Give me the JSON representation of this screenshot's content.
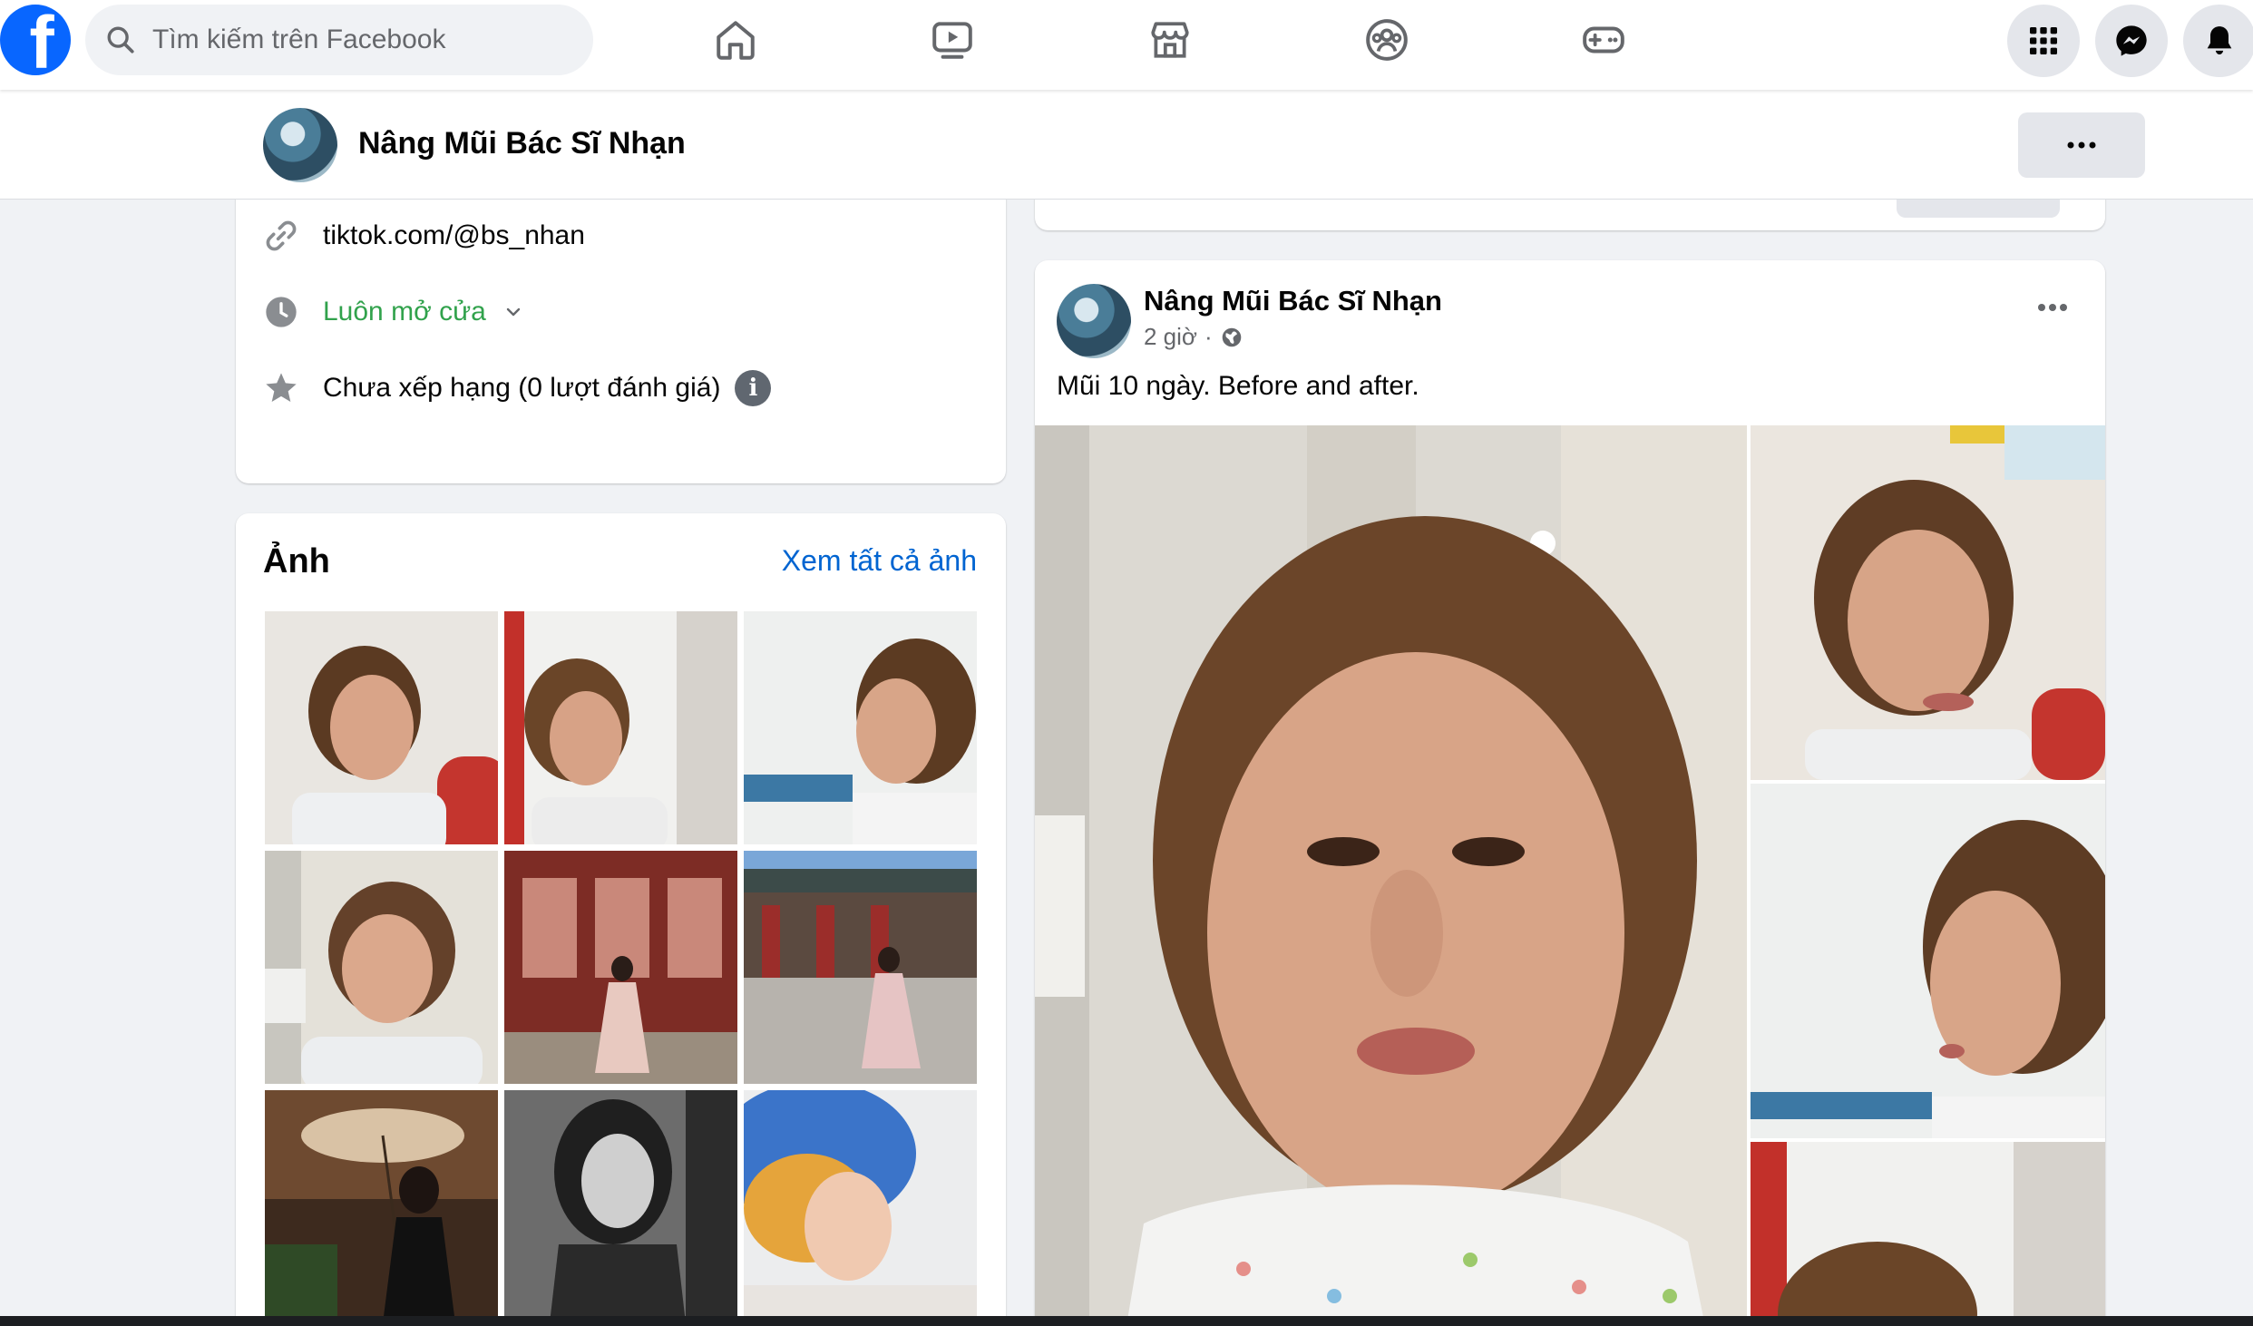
{
  "topbar": {
    "logo_letter": "f",
    "search_placeholder": "Tìm kiếm trên Facebook",
    "nav_icons": [
      "home-icon",
      "video-icon",
      "marketplace-icon",
      "groups-icon",
      "gaming-icon"
    ],
    "right_icons": [
      "menu-grid-icon",
      "messenger-icon",
      "notifications-bell-icon"
    ]
  },
  "page_header": {
    "page_name": "Nâng Mũi Bác Sĩ Nhạn"
  },
  "intro": {
    "website": "tiktok.com/@bs_nhan",
    "hours": "Luôn mở cửa",
    "rating": "Chưa xếp hạng (0 lượt đánh giá)"
  },
  "photos": {
    "title": "Ảnh",
    "see_all": "Xem tất cả ảnh"
  },
  "post": {
    "author": "Nâng Mũi Bác Sĩ Nhạn",
    "time": "2 giờ",
    "separator": "·",
    "audience_icon": "globe-icon",
    "text": "Mũi 10 ngày. Before and after."
  },
  "colors": {
    "brand_blue": "#0866ff",
    "link_blue": "#0064d1",
    "open_green": "#31a24c",
    "page_bg": "#f0f2f5"
  }
}
